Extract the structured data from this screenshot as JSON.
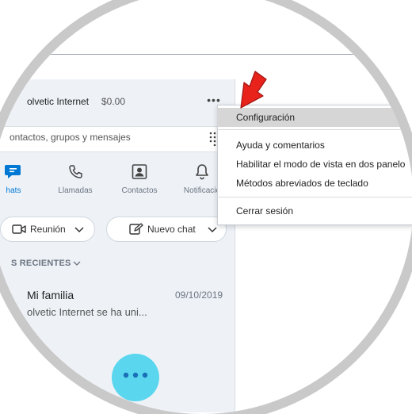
{
  "profile": {
    "name": "olvetic Internet",
    "credit": "$0.00",
    "more_glyph": "•••"
  },
  "search": {
    "placeholder": "ontactos, grupos y mensajes"
  },
  "nav": [
    {
      "label": "hats",
      "icon": "chat-icon",
      "active": true
    },
    {
      "label": "Llamadas",
      "icon": "phone-icon",
      "active": false
    },
    {
      "label": "Contactos",
      "icon": "contacts-icon",
      "active": false
    },
    {
      "label": "Notificacio",
      "icon": "bell-icon",
      "active": false
    }
  ],
  "actions": {
    "meeting_label": "Reunión",
    "new_chat_label": "Nuevo chat"
  },
  "recent": {
    "heading": "S RECIENTES",
    "conversations": [
      {
        "name": "Mi familia",
        "date": "09/10/2019",
        "preview": "olvetic Internet se ha uni..."
      }
    ]
  },
  "menu": {
    "items": [
      {
        "label": "Configuración",
        "highlighted": true
      },
      {
        "label": "Ayuda y comentarios"
      },
      {
        "label": "Habilitar el modo de vista en dos panelo"
      },
      {
        "label": "Métodos abreviados de teclado"
      },
      {
        "label": "Cerrar sesión"
      }
    ]
  },
  "colors": {
    "accent": "#0078d4",
    "fab": "#5ad6ee",
    "panel_bg": "#eef2f7",
    "arrow": "#e8231c",
    "menu_highlight": "#d6d6d6"
  }
}
